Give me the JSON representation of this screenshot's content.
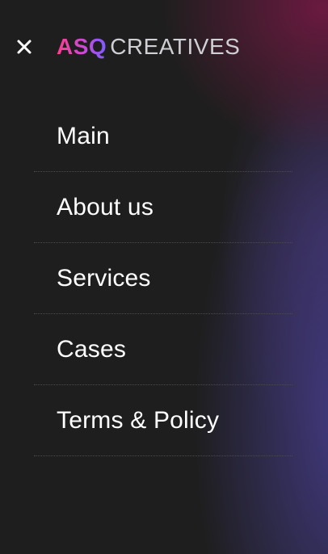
{
  "logo": {
    "part1": "ASQ",
    "part2": "CREATIVES"
  },
  "header": {
    "close_icon": "close-icon"
  },
  "nav": {
    "items": [
      {
        "label": "Main"
      },
      {
        "label": "About us"
      },
      {
        "label": "Services"
      },
      {
        "label": "Cases"
      },
      {
        "label": "Terms & Policy"
      }
    ]
  },
  "colors": {
    "background": "#1e1e1e",
    "logo_gradient_start": "#ff3d8e",
    "logo_gradient_end": "#7a5cff",
    "text": "#ffffff"
  }
}
